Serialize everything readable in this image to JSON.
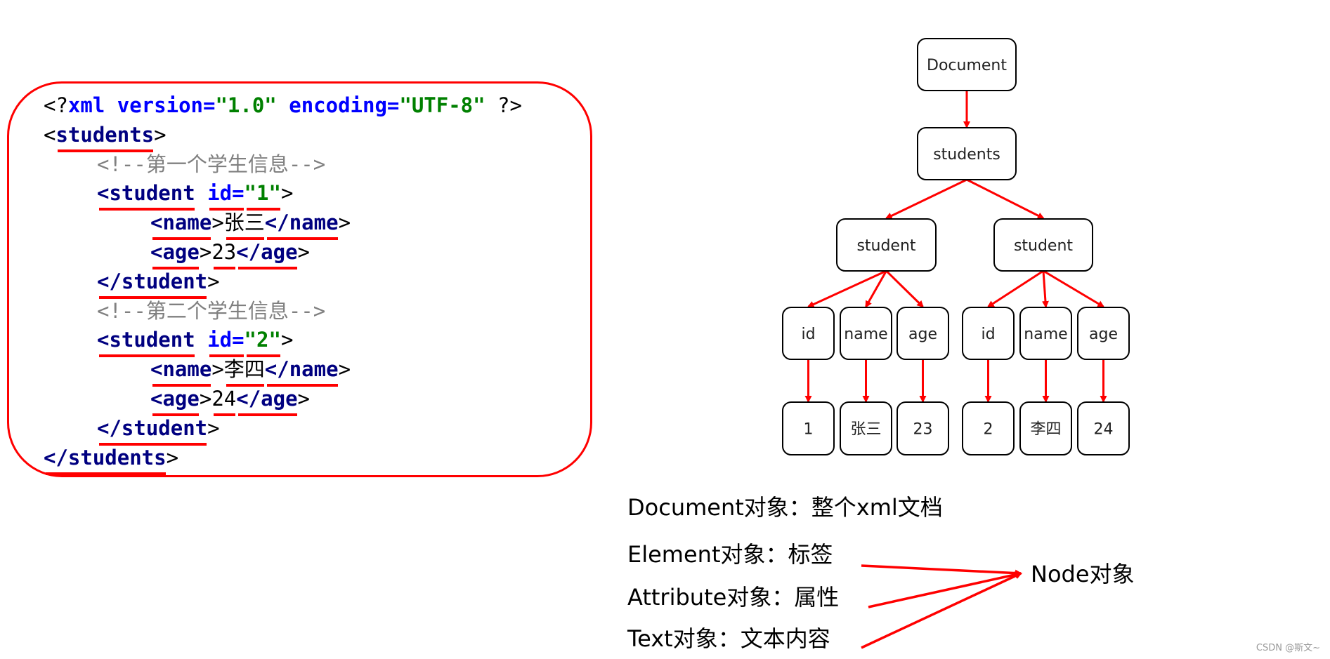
{
  "code": {
    "lines": [
      {
        "indent": 0,
        "tokens": [
          {
            "t": "<?",
            "c": "punct"
          },
          {
            "t": "xml ",
            "c": "pi"
          },
          {
            "t": "version=",
            "c": "pi"
          },
          {
            "t": "\"1.0\"",
            "c": "val"
          },
          {
            "t": " ",
            "c": "punct"
          },
          {
            "t": "encoding=",
            "c": "pi"
          },
          {
            "t": "\"UTF-8\"",
            "c": "val"
          },
          {
            "t": " ?>",
            "c": "punct"
          }
        ]
      },
      {
        "indent": 0,
        "tokens": [
          {
            "t": "<",
            "c": "punct"
          },
          {
            "t": "students",
            "c": "tag",
            "ul": true
          },
          {
            "t": ">",
            "c": "punct"
          }
        ]
      },
      {
        "indent": 1,
        "tokens": [
          {
            "t": "<!--第一个学生信息-->",
            "c": "cmt"
          }
        ]
      },
      {
        "indent": 1,
        "tokens": [
          {
            "t": "<student",
            "c": "tag",
            "ul": true
          },
          {
            "t": " ",
            "c": "punct"
          },
          {
            "t": "id=",
            "c": "attr",
            "ul": true
          },
          {
            "t": "\"1\"",
            "c": "val",
            "ul": true
          },
          {
            "t": ">",
            "c": "punct"
          }
        ]
      },
      {
        "indent": 2,
        "tokens": [
          {
            "t": "<name",
            "c": "tag",
            "ul": true
          },
          {
            "t": ">",
            "c": "punct"
          },
          {
            "t": "张三",
            "c": "txt",
            "ul": true
          },
          {
            "t": "</name",
            "c": "tag",
            "ul": true
          },
          {
            "t": ">",
            "c": "punct"
          }
        ]
      },
      {
        "indent": 2,
        "tokens": [
          {
            "t": "<age",
            "c": "tag",
            "ul": true
          },
          {
            "t": ">",
            "c": "punct"
          },
          {
            "t": "23",
            "c": "txt",
            "ul": true
          },
          {
            "t": "</age",
            "c": "tag",
            "ul": true
          },
          {
            "t": ">",
            "c": "punct"
          }
        ]
      },
      {
        "indent": 1,
        "tokens": [
          {
            "t": "</student",
            "c": "tag",
            "ul": true
          },
          {
            "t": ">",
            "c": "punct"
          }
        ]
      },
      {
        "indent": 1,
        "tokens": [
          {
            "t": "<!--第二个学生信息-->",
            "c": "cmt"
          }
        ]
      },
      {
        "indent": 1,
        "tokens": [
          {
            "t": "<student",
            "c": "tag",
            "ul": true
          },
          {
            "t": " ",
            "c": "punct"
          },
          {
            "t": "id=",
            "c": "attr",
            "ul": true
          },
          {
            "t": "\"2\"",
            "c": "val",
            "ul": true
          },
          {
            "t": ">",
            "c": "punct"
          }
        ]
      },
      {
        "indent": 2,
        "tokens": [
          {
            "t": "<name",
            "c": "tag",
            "ul": true
          },
          {
            "t": ">",
            "c": "punct"
          },
          {
            "t": "李四",
            "c": "txt",
            "ul": true
          },
          {
            "t": "</name",
            "c": "tag",
            "ul": true
          },
          {
            "t": ">",
            "c": "punct"
          }
        ]
      },
      {
        "indent": 2,
        "tokens": [
          {
            "t": "<age",
            "c": "tag",
            "ul": true
          },
          {
            "t": ">",
            "c": "punct"
          },
          {
            "t": "24",
            "c": "txt",
            "ul": true
          },
          {
            "t": "</age",
            "c": "tag",
            "ul": true
          },
          {
            "t": ">",
            "c": "punct"
          }
        ]
      },
      {
        "indent": 1,
        "tokens": [
          {
            "t": "</student",
            "c": "tag",
            "ul": true
          },
          {
            "t": ">",
            "c": "punct"
          }
        ]
      },
      {
        "indent": 0,
        "tokens": [
          {
            "t": "</students",
            "c": "tag",
            "ul": true
          },
          {
            "t": ">",
            "c": "punct"
          }
        ]
      }
    ]
  },
  "tree": {
    "nodes": {
      "document": "Document",
      "students": "students",
      "student1": "student",
      "student2": "student",
      "id1": "id",
      "name1": "name",
      "age1": "age",
      "id2": "id",
      "name2": "name",
      "age2": "age",
      "v_id1": "1",
      "v_name1": "张三",
      "v_age1": "23",
      "v_id2": "2",
      "v_name2": "李四",
      "v_age2": "24"
    }
  },
  "legend": {
    "document": "Document对象：整个xml文档",
    "element": "Element对象：标签",
    "attribute": "Attribute对象：属性",
    "text": "Text对象：文本内容",
    "node": "Node对象"
  },
  "colors": {
    "accent": "#ff0000",
    "tag": "#000080",
    "attribute": "#0000ff",
    "value": "#008000",
    "comment": "#808080"
  },
  "watermark": "CSDN @斯文~"
}
